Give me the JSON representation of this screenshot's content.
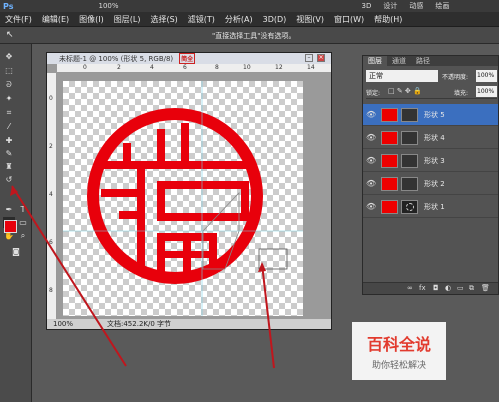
{
  "app": {
    "logo": "Ps",
    "zoom": "100%",
    "workspace_buttons": [
      "3D",
      "设计",
      "动感",
      "绘画"
    ],
    "menu": [
      "文件(F)",
      "编辑(E)",
      "图像(I)",
      "图层(L)",
      "选择(S)",
      "滤镜(T)",
      "分析(A)",
      "3D(D)",
      "视图(V)",
      "窗口(W)",
      "帮助(H)"
    ]
  },
  "options": {
    "message": "\"直接选择工具\"没有选项。"
  },
  "document": {
    "title": "未标题-1 @ 100% (形状 5, RGB/8)",
    "stamp": "简全",
    "zoom": "100%",
    "doc_info": "文档:452.2K/0 字节",
    "ruler_marks": [
      "0",
      "2",
      "4",
      "6",
      "8",
      "10",
      "12",
      "14"
    ],
    "ruler_marks_v": [
      "0",
      "2",
      "4",
      "6",
      "8"
    ]
  },
  "layers_panel": {
    "tabs": [
      "图层",
      "通道",
      "路径"
    ],
    "blend_mode": "正常",
    "opacity_label": "不透明度:",
    "opacity": "100%",
    "lock_label": "锁定:",
    "fill_label": "填充:",
    "fill": "100%",
    "layers": [
      {
        "name": "形状 5",
        "selected": true
      },
      {
        "name": "形状 4",
        "selected": false
      },
      {
        "name": "形状 3",
        "selected": false
      },
      {
        "name": "形状 2",
        "selected": false
      },
      {
        "name": "形状 1",
        "selected": false
      }
    ]
  },
  "watermark": {
    "title": "百科全说",
    "subtitle": "助你轻松解决"
  },
  "colors": {
    "foreground": "#e8000b",
    "shape_red": "#e8000b",
    "selected_layer": "#3b6fbf"
  }
}
